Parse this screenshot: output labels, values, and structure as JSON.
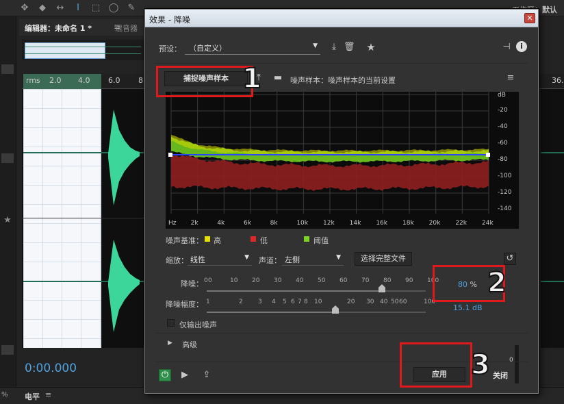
{
  "app": {
    "workspace_label": "工作区：",
    "workspace_value": "默认",
    "editor_tab": "编辑器：未命名 1 *",
    "editor_menu": "≡",
    "mixer_tab": "混音器",
    "ruler_ticks": [
      "rms",
      "2.0",
      "4.0",
      "6.0",
      "8."
    ],
    "ruler_right": "36.",
    "timecode": "0:00.000",
    "level_label": "电平",
    "level_menu": "≡",
    "zoom": "%"
  },
  "dialog": {
    "title": "效果 - 降噪",
    "close": "✕",
    "preset_label": "预设：",
    "preset_value": "（自定义）",
    "capture_button": "捕捉噪声样本",
    "noise_sample_text": "噪声样本：噪声样本的当前设置",
    "menu_icon": "≡",
    "db_unit": "dB",
    "db_ticks": [
      "-20",
      "-40",
      "-60",
      "-80",
      "-100",
      "-120",
      "-140"
    ],
    "hz_ticks": [
      "Hz",
      "2k",
      "4k",
      "6k",
      "8k",
      "10k",
      "12k",
      "14k",
      "16k",
      "18k",
      "20k",
      "22k",
      "24k"
    ],
    "legend_title": "噪声基准：",
    "legend": [
      {
        "label": "高",
        "color": "#e3e000"
      },
      {
        "label": "低",
        "color": "#d92a2a"
      },
      {
        "label": "阈值",
        "color": "#7ed321"
      }
    ],
    "scale_label": "缩放：",
    "scale_value": "线性",
    "channel_label": "声道：",
    "channel_value": "左侧",
    "select_file_button": "选择完整文件",
    "reduction_label": "降噪：",
    "reduction_scale": [
      "0",
      "0",
      "10",
      "20",
      "30",
      "40",
      "50",
      "60",
      "70",
      "80",
      "90",
      "100"
    ],
    "reduction_value": "80",
    "reduction_unit": "%",
    "reduction_level": 0.8,
    "reduce_by_label": "降噪幅度：",
    "reduce_by_scale": [
      "1",
      "2",
      "3",
      "4",
      "5",
      "6",
      "7",
      "8",
      "10",
      "20",
      "30",
      "40",
      "50",
      "60",
      "100"
    ],
    "reduce_by_value": "15.1 dB",
    "output_noise_only": "仅输出噪声",
    "advanced_label": "高级",
    "meter_zero": "0",
    "apply_button": "应用",
    "close_button": "关闭",
    "annotation_1": "1",
    "annotation_2": "2",
    "annotation_3": "3"
  }
}
